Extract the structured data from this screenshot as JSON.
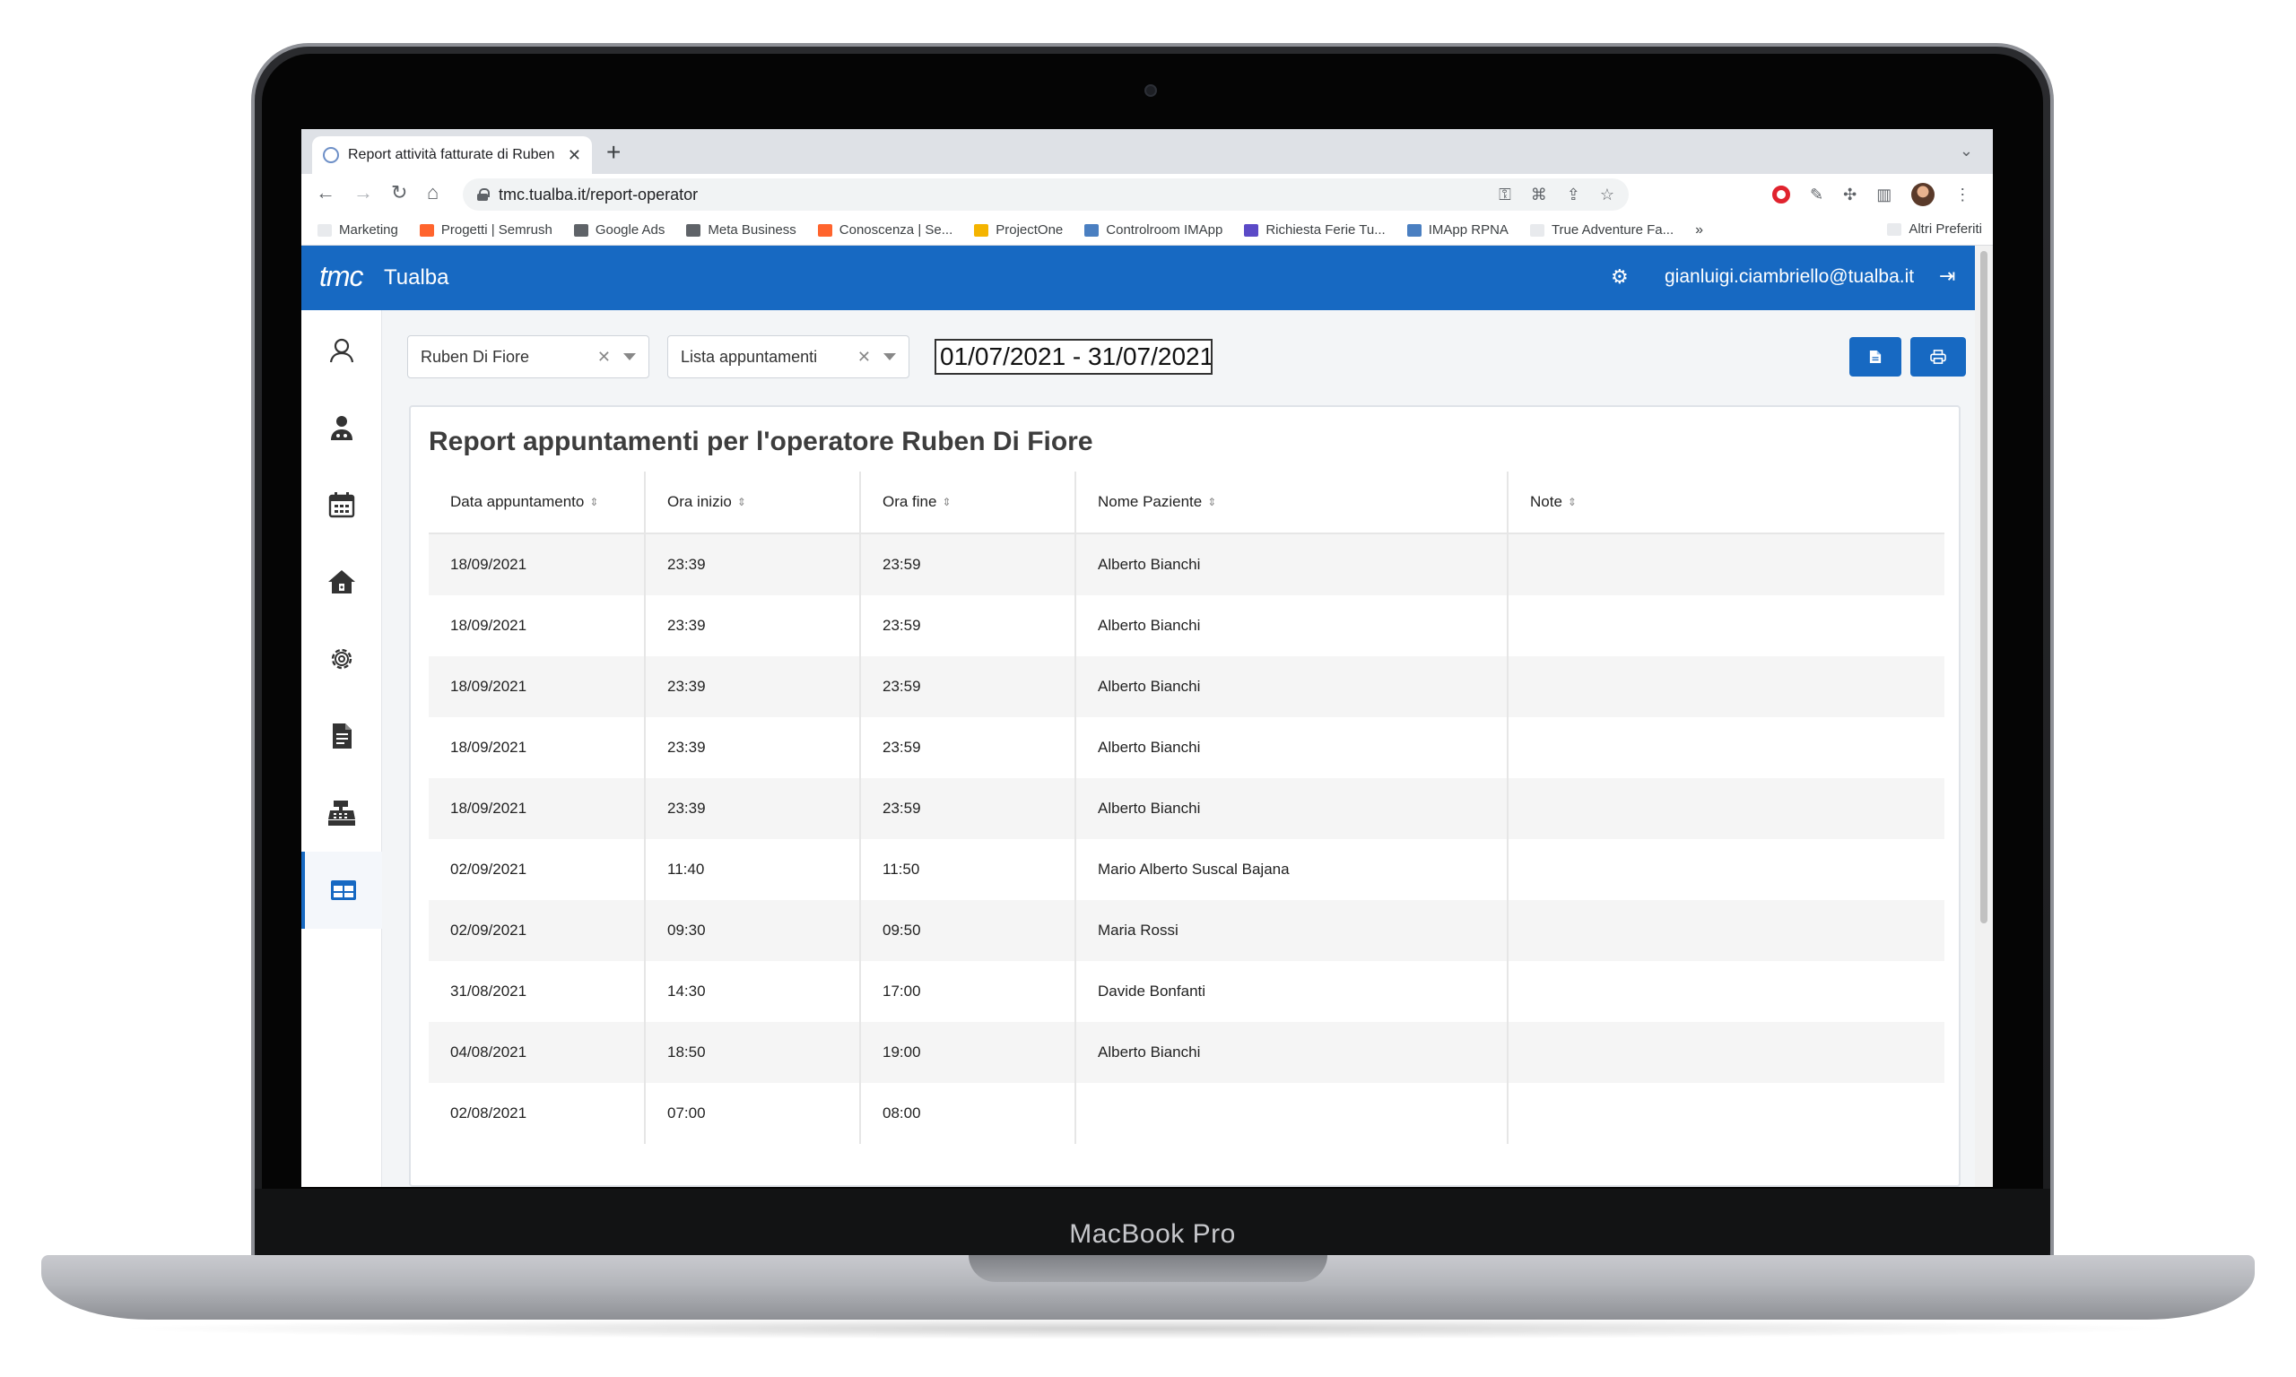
{
  "device": {
    "brand": "MacBook Pro"
  },
  "browser": {
    "tab_title": "Report attività fatturate di Ruben Di Fiore",
    "url": "tmc.tualba.it/report-operator",
    "bookmarks": [
      {
        "label": "Marketing",
        "color": "#e8eaed"
      },
      {
        "label": "Progetti | Semrush",
        "color": "#ff642d"
      },
      {
        "label": "Google Ads",
        "color": "#5f6368"
      },
      {
        "label": "Meta Business",
        "color": "#5f6368"
      },
      {
        "label": "Conoscenza | Se...",
        "color": "#ff642d"
      },
      {
        "label": "ProjectOne",
        "color": "#f4b400"
      },
      {
        "label": "Controlroom IMApp",
        "color": "#4a7fc1"
      },
      {
        "label": "Richiesta Ferie Tu...",
        "color": "#5b4ac7"
      },
      {
        "label": "IMApp RPNA",
        "color": "#4a7fc1"
      },
      {
        "label": "True Adventure Fa...",
        "color": "#e8eaed"
      }
    ],
    "bookmarks_more": "»",
    "other_bookmarks": "Altri Preferiti"
  },
  "app": {
    "logo": "tmc",
    "name": "Tualba",
    "user_email": "gianluigi.ciambriello@tualba.it",
    "accent": "#1769c2"
  },
  "filters": {
    "operator": "Ruben Di Fiore",
    "report_type": "Lista appuntamenti",
    "date_range": "01/07/2021 - 31/07/2021"
  },
  "report": {
    "title": "Report appuntamenti per l'operatore Ruben Di Fiore",
    "columns": [
      "Data appuntamento",
      "Ora inizio",
      "Ora fine",
      "Nome Paziente",
      "Note"
    ],
    "rows": [
      [
        "18/09/2021",
        "23:39",
        "23:59",
        "Alberto Bianchi",
        ""
      ],
      [
        "18/09/2021",
        "23:39",
        "23:59",
        "Alberto Bianchi",
        ""
      ],
      [
        "18/09/2021",
        "23:39",
        "23:59",
        "Alberto Bianchi",
        ""
      ],
      [
        "18/09/2021",
        "23:39",
        "23:59",
        "Alberto Bianchi",
        ""
      ],
      [
        "18/09/2021",
        "23:39",
        "23:59",
        "Alberto Bianchi",
        ""
      ],
      [
        "02/09/2021",
        "11:40",
        "11:50",
        "Mario Alberto Suscal Bajana",
        ""
      ],
      [
        "02/09/2021",
        "09:30",
        "09:50",
        "Maria Rossi",
        ""
      ],
      [
        "31/08/2021",
        "14:30",
        "17:00",
        "Davide Bonfanti",
        ""
      ],
      [
        "04/08/2021",
        "18:50",
        "19:00",
        "Alberto Bianchi",
        ""
      ],
      [
        "02/08/2021",
        "07:00",
        "08:00",
        "",
        ""
      ]
    ]
  }
}
